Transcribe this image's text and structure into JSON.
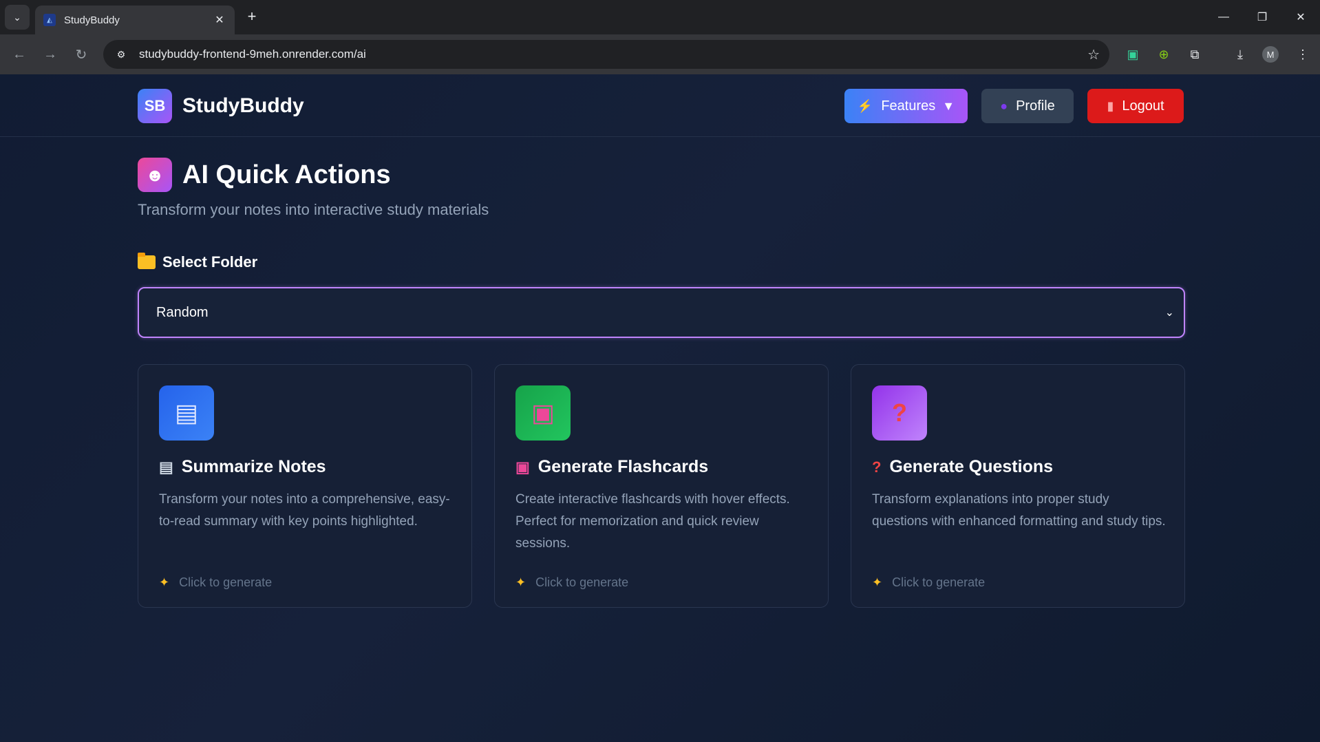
{
  "browser": {
    "tab_title": "StudyBuddy",
    "url": "studybuddy-frontend-9meh.onrender.com/ai",
    "profile_initial": "M"
  },
  "header": {
    "logo_text": "SB",
    "brand_name": "StudyBuddy",
    "features_label": "Features",
    "profile_label": "Profile",
    "logout_label": "Logout"
  },
  "page": {
    "title": "AI Quick Actions",
    "subtitle": "Transform your notes into interactive study materials"
  },
  "folder": {
    "label": "Select Folder",
    "selected": "Random"
  },
  "cards": [
    {
      "title": "Summarize Notes",
      "description": "Transform your notes into a comprehensive, easy-to-read summary with key points highlighted.",
      "cta": "Click to generate",
      "icon": "document-icon",
      "color": "#3b82f6"
    },
    {
      "title": "Generate Flashcards",
      "description": "Create interactive flashcards with hover effects. Perfect for memorization and quick review sessions.",
      "cta": "Click to generate",
      "icon": "flashcard-icon",
      "color": "#16a34a"
    },
    {
      "title": "Generate Questions",
      "description": "Transform explanations into proper study questions with enhanced formatting and study tips.",
      "cta": "Click to generate",
      "icon": "question-icon",
      "color": "#a855f7"
    }
  ]
}
